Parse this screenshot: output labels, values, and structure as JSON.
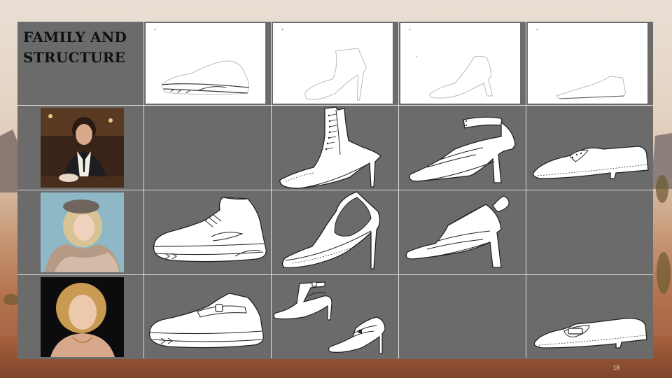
{
  "slide": {
    "title": "FAMILY AND STRUCTURE",
    "page_number": "18"
  },
  "rows": [
    {
      "kind": "technical-sketches",
      "cells": [
        "sneaker-sketch",
        "bootie-sketch",
        "pump-sketch",
        "flat-sketch"
      ]
    },
    {
      "portrait": "portrait-woman-waistcoat",
      "cells": [
        "empty",
        "lace-up-ankle-boot",
        "strappy-sandal",
        "lace-up-oxford-flat"
      ]
    },
    {
      "portrait": "portrait-woman-beret-fur",
      "cells": [
        "chunky-sneaker",
        "cutout-bootie",
        "t-strap-sandal",
        "empty"
      ]
    },
    {
      "portrait": "portrait-woman-blonde-curls",
      "cells": [
        "buckle-sneaker",
        "strap-heels-pair",
        "empty",
        "buckle-loafer"
      ]
    }
  ],
  "colors": {
    "cell_fill": "#6b6b6b",
    "grid_line": "#dcdcdc",
    "shoe_fill": "#ffffff",
    "shoe_stroke": "#222222"
  }
}
